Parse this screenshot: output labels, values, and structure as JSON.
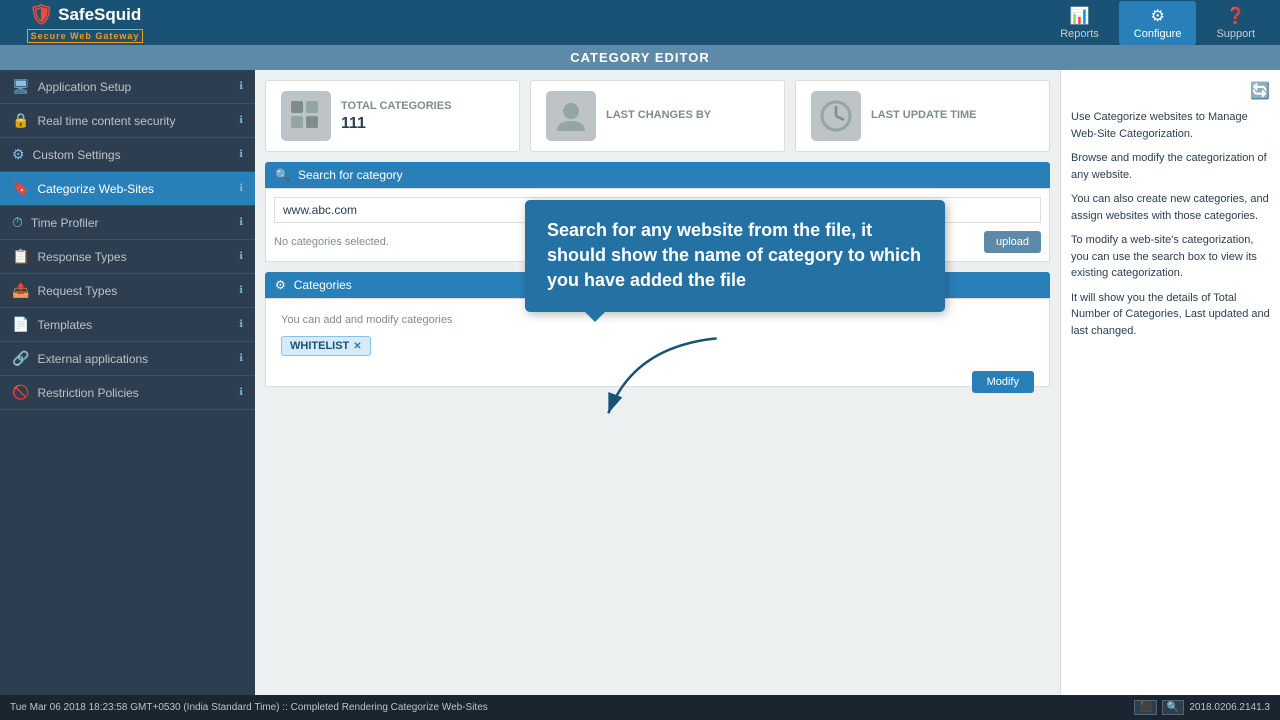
{
  "nav": {
    "logo_name": "SafeSquid",
    "logo_subtitle": "Secure Web Gateway",
    "reports_label": "Reports",
    "configure_label": "Configure",
    "support_label": "Support"
  },
  "page": {
    "title": "CATEGORY EDITOR"
  },
  "sidebar": {
    "items": [
      {
        "id": "application-setup",
        "label": "Application Setup",
        "icon": "🖥",
        "active": false
      },
      {
        "id": "real-time-content-security",
        "label": "Real time content security",
        "icon": "🔒",
        "active": false
      },
      {
        "id": "custom-settings",
        "label": "Custom Settings",
        "icon": "⚙",
        "active": false
      },
      {
        "id": "categorize-web-sites",
        "label": "Categorize Web-Sites",
        "icon": "🔖",
        "active": true
      },
      {
        "id": "time-profiler",
        "label": "Time Profiler",
        "icon": "⏱",
        "active": false
      },
      {
        "id": "response-types",
        "label": "Response Types",
        "icon": "📋",
        "active": false
      },
      {
        "id": "request-types",
        "label": "Request Types",
        "icon": "📤",
        "active": false
      },
      {
        "id": "templates",
        "label": "Templates",
        "icon": "📄",
        "active": false
      },
      {
        "id": "external-applications",
        "label": "External applications",
        "icon": "🔗",
        "active": false
      },
      {
        "id": "restriction-policies",
        "label": "Restriction Policies",
        "icon": "🚫",
        "active": false
      }
    ]
  },
  "stats": [
    {
      "id": "total-categories",
      "label": "TOTAL CATEGORIES",
      "value": "111",
      "icon": "🧩"
    },
    {
      "id": "last-changes-by",
      "label": "LAST CHANGES BY",
      "value": "",
      "icon": "👤"
    },
    {
      "id": "last-update-time",
      "label": "LAST UPDATE TIME",
      "value": "",
      "icon": "🕐"
    }
  ],
  "search": {
    "placeholder": "Search for category",
    "value": "www.abc.com",
    "results_text": "No categories selected.",
    "upload_label": "upload"
  },
  "categories": {
    "header": "Categories",
    "hint": "You can add and modify categories",
    "tag": "WHITELIST",
    "modify_label": "Modify"
  },
  "right_panel": {
    "lines": [
      "Use Categorize websites to Manage Web-Site Categorization.",
      "Browse and modify the categorization of any website.",
      "You can also create new categories, and assign websites with those categories.",
      "To modify a web-site's categorization, you can use the search box to view its existing categorization.",
      "It will show you the details of Total Number of Categories, Last updated and last changed."
    ]
  },
  "callout": {
    "text": "Search for any website from the file, it should show the name of category to which you have added the file"
  },
  "status_bar": {
    "text": "Tue Mar 06 2018 18:23:58 GMT+0530 (India Standard Time) :: Completed Rendering Categorize Web-Sites",
    "version": "2018.0206.2141.3"
  }
}
